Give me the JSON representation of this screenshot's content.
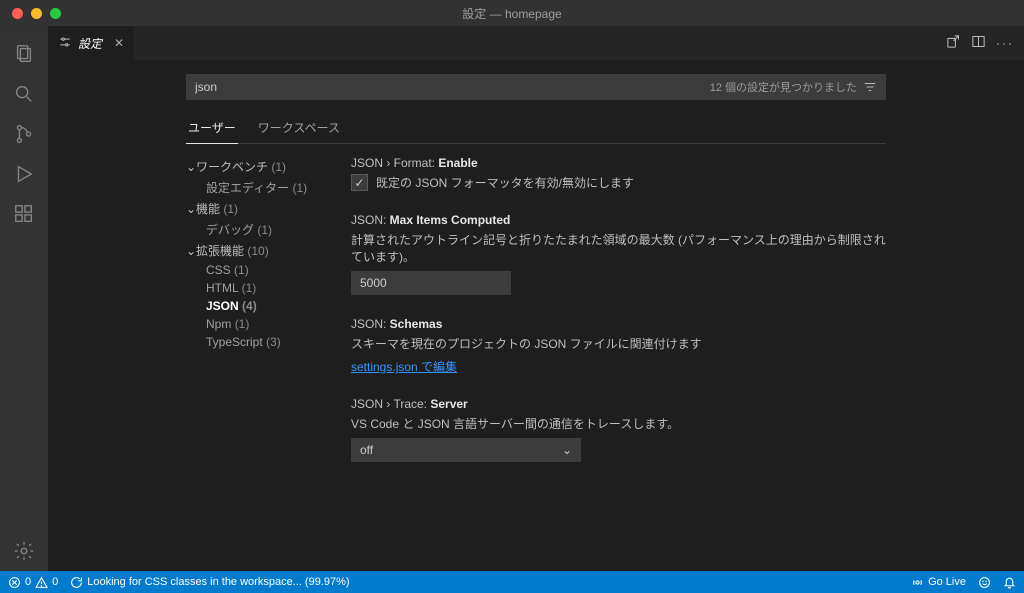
{
  "titlebar": {
    "title": "設定 — homepage"
  },
  "tab": {
    "label": "設定"
  },
  "search": {
    "value": "json",
    "count_text": "12 個の設定が見つかりました"
  },
  "scope": {
    "user": "ユーザー",
    "workspace": "ワークスペース"
  },
  "toc": {
    "workbench": {
      "label": "ワークベンチ",
      "count": "(1)"
    },
    "settings_editor": {
      "label": "設定エディター",
      "count": "(1)"
    },
    "features": {
      "label": "機能",
      "count": "(1)"
    },
    "debug": {
      "label": "デバッグ",
      "count": "(1)"
    },
    "extensions": {
      "label": "拡張機能",
      "count": "(10)"
    },
    "css": {
      "label": "CSS",
      "count": "(1)"
    },
    "html": {
      "label": "HTML",
      "count": "(1)"
    },
    "json": {
      "label": "JSON",
      "count": "(4)"
    },
    "npm": {
      "label": "Npm",
      "count": "(1)"
    },
    "typescript": {
      "label": "TypeScript",
      "count": "(3)"
    }
  },
  "settings": {
    "format_enable": {
      "prefix": "JSON › Format: ",
      "name": "Enable",
      "desc": "既定の JSON フォーマッタを有効/無効にします",
      "checked": true
    },
    "max_items": {
      "prefix": "JSON: ",
      "name": "Max Items Computed",
      "desc": "計算されたアウトライン記号と折りたたまれた領域の最大数 (パフォーマンス上の理由から制限されています)。",
      "value": "5000"
    },
    "schemas": {
      "prefix": "JSON: ",
      "name": "Schemas",
      "desc": "スキーマを現在のプロジェクトの JSON ファイルに関連付けます",
      "link": "settings.json で編集"
    },
    "trace": {
      "prefix": "JSON › Trace: ",
      "name": "Server",
      "desc": "VS Code と JSON 言語サーバー間の通信をトレースします。",
      "value": "off"
    }
  },
  "status": {
    "errors": "0",
    "warnings": "0",
    "scan": "Looking for CSS classes in the workspace... (99.97%)",
    "golive": "Go Live"
  }
}
